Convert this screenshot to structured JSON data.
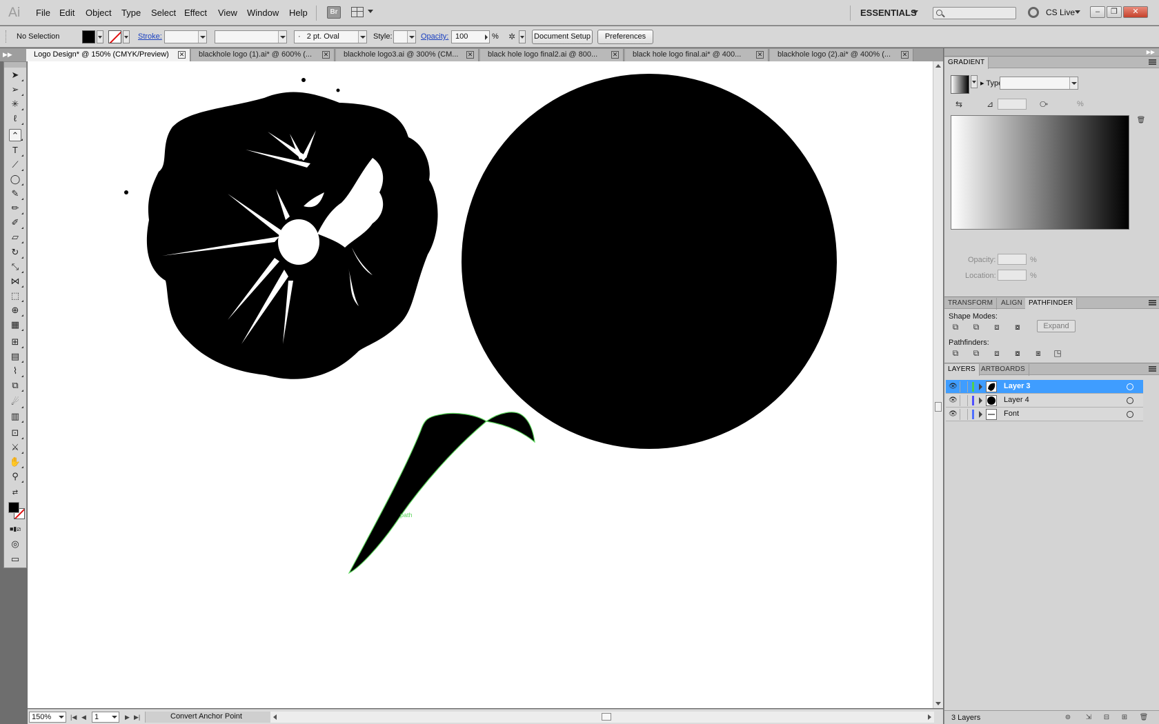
{
  "app": {
    "logo": "Ai",
    "workspace": "ESSENTIALS",
    "cs_live": "CS Live",
    "bridge": "Br"
  },
  "menu": [
    "File",
    "Edit",
    "Object",
    "Type",
    "Select",
    "Effect",
    "View",
    "Window",
    "Help"
  ],
  "control_bar": {
    "selection": "No Selection",
    "stroke_label": "Stroke:",
    "brush": "2 pt. Oval",
    "brush_dot": "·",
    "style_label": "Style:",
    "opacity_label": "Opacity:",
    "opacity_value": "100",
    "percent": "%",
    "document_setup": "Document Setup",
    "preferences": "Preferences"
  },
  "tabs": [
    {
      "label": "Logo Design* @ 150% (CMYK/Preview)",
      "active": true
    },
    {
      "label": "blackhole logo (1).ai* @ 600% (...",
      "active": false
    },
    {
      "label": "blackhole logo3.ai @ 300% (CM...",
      "active": false
    },
    {
      "label": "black hole logo final2.ai @ 800...",
      "active": false
    },
    {
      "label": "black hole logo final.ai* @ 400...",
      "active": false
    },
    {
      "label": "blackhole logo (2).ai* @ 400% (...",
      "active": false
    }
  ],
  "canvas": {
    "path_hint": "path"
  },
  "status": {
    "zoom": "150%",
    "page": "1",
    "tool": "Convert Anchor Point"
  },
  "gradient_panel": {
    "title": "GRADIENT",
    "type_label": "Type:",
    "percent": "%",
    "opacity_label": "Opacity:",
    "location_label": "Location:"
  },
  "pathfinder_panel": {
    "tabs": [
      "TRANSFORM",
      "ALIGN",
      "PATHFINDER"
    ],
    "active_tab": "PATHFINDER",
    "shape_modes_label": "Shape Modes:",
    "expand": "Expand",
    "pathfinders_label": "Pathfinders:"
  },
  "layers_panel": {
    "tabs": [
      "LAYERS",
      "ARTBOARDS"
    ],
    "layers": [
      {
        "name": "Layer 3",
        "selected": true,
        "color": "#4fcf4f"
      },
      {
        "name": "Layer 4",
        "selected": false,
        "color": "#4f4fff"
      },
      {
        "name": "Font",
        "selected": false,
        "color": "#4f6fff"
      }
    ],
    "count": "3 Layers"
  },
  "colors": {
    "accent": "#3f9dff",
    "path_outline": "#5cd65c",
    "artwork": "#000000",
    "link": "#1a40c0"
  }
}
